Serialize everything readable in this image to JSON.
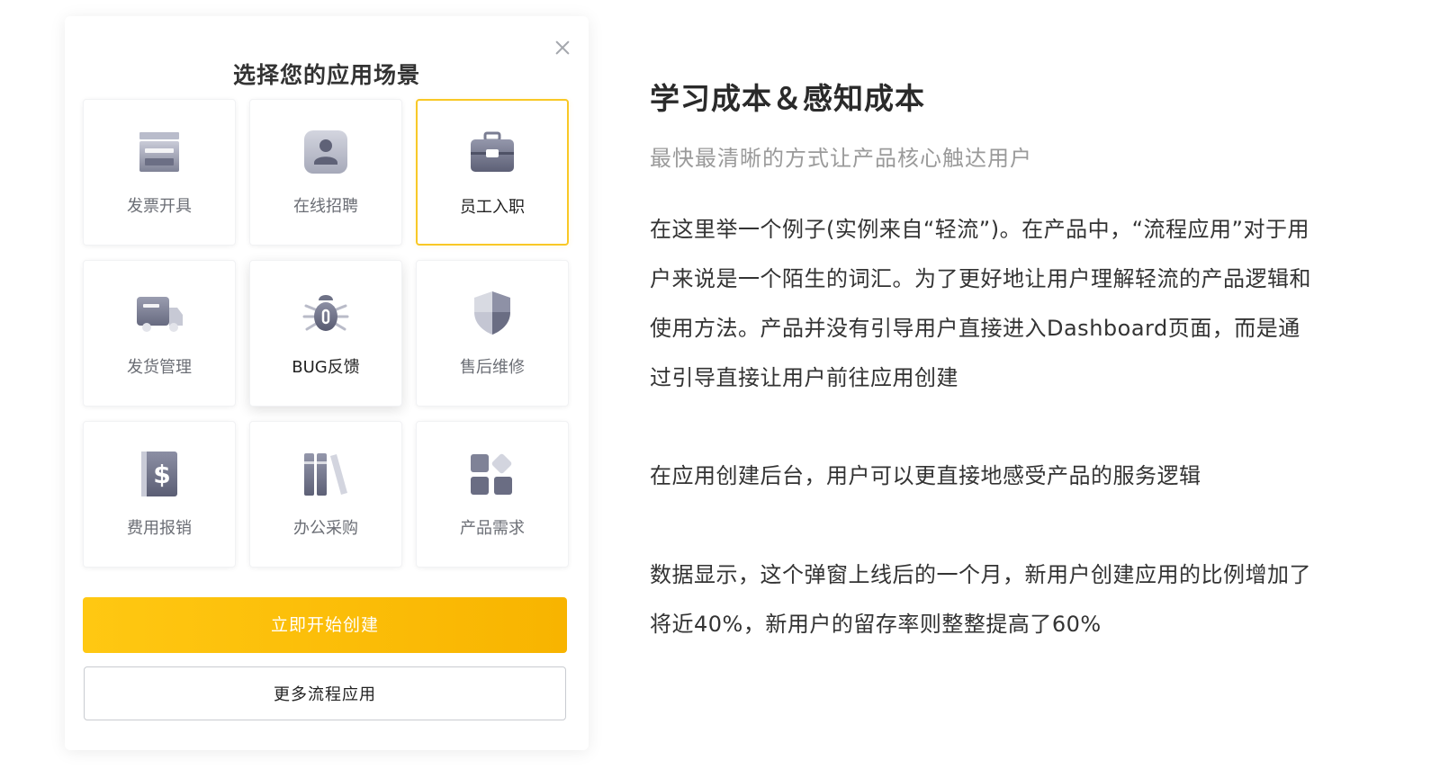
{
  "modal": {
    "title": "选择您的应用场景",
    "close_label": "×",
    "cards": [
      {
        "label": "发票开具",
        "icon": "invoice-icon",
        "state": "normal"
      },
      {
        "label": "在线招聘",
        "icon": "recruit-person-icon",
        "state": "normal"
      },
      {
        "label": "员工入职",
        "icon": "briefcase-icon",
        "state": "selected"
      },
      {
        "label": "发货管理",
        "icon": "truck-icon",
        "state": "normal"
      },
      {
        "label": "BUG反馈",
        "icon": "bug-icon",
        "state": "hover"
      },
      {
        "label": "售后维修",
        "icon": "shield-icon",
        "state": "normal"
      },
      {
        "label": "费用报销",
        "icon": "dollar-icon",
        "state": "normal"
      },
      {
        "label": "办公采购",
        "icon": "books-icon",
        "state": "normal"
      },
      {
        "label": "产品需求",
        "icon": "blocks-icon",
        "state": "normal"
      }
    ],
    "primary_button": "立即开始创建",
    "secondary_button": "更多流程应用",
    "colors": {
      "accent": "#ffc812",
      "accent_end": "#f8b400",
      "selected_border": "#f9c826",
      "icon_gray": "#8a8da0"
    }
  },
  "article": {
    "title": "学习成本＆感知成本",
    "subtitle": "最快最清晰的方式让产品核心触达用户",
    "p1_lines": [
      "在这里举一个例子(实例来自“轻流”)。在产品中，“流程应用”对于用",
      "户来说是一个陌生的词汇。为了更好地让用户理解轻流的产品逻辑和",
      "使用方法。产品并没有引导用户直接进入Dashboard页面，而是通",
      "过引导直接让用户前往应用创建"
    ],
    "p2": "在应用创建后台，用户可以更直接地感受产品的服务逻辑",
    "p3_lines": [
      "数据显示，这个弹窗上线后的一个月，新用户创建应用的比例增加了",
      "将近40%，新用户的留存率则整整提高了60%"
    ]
  }
}
